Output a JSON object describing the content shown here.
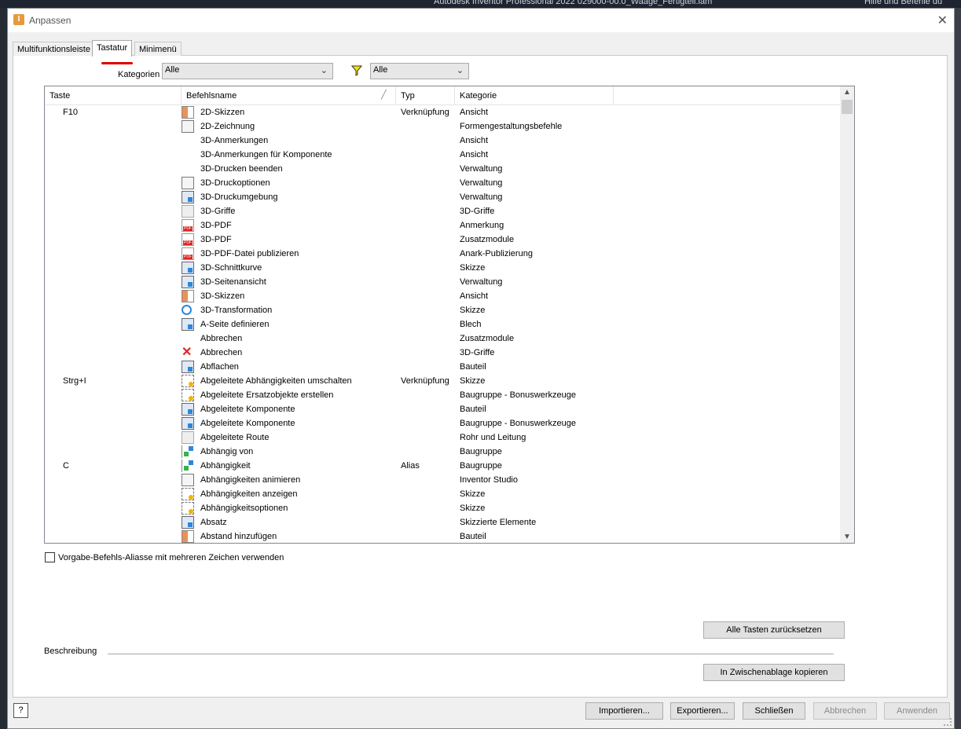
{
  "background_app": {
    "title": "Autodesk Inventor Professional 2022   029000-00.0_Waage_Fertigteil.iam",
    "right_text": "Hilfe und Befehle du"
  },
  "dialog": {
    "title": "Anpassen",
    "tabs": [
      {
        "label": "Multifunktionsleiste",
        "active": false
      },
      {
        "label": "Tastatur",
        "active": true
      },
      {
        "label": "Minimenü",
        "active": false
      }
    ]
  },
  "filters": {
    "categories_label": "Kategorien",
    "categories_value": "Alle",
    "type_value": "Alle"
  },
  "table": {
    "columns": [
      "Taste",
      "Befehlsname",
      "Typ",
      "Kategorie"
    ],
    "rows": [
      {
        "key": "F10",
        "icon": "sketch",
        "name": "2D-Skizzen",
        "type": "Verknüpfung",
        "category": "Ansicht"
      },
      {
        "key": "",
        "icon": "doc",
        "name": "2D-Zeichnung",
        "type": "",
        "category": "Formengestaltungsbefehle"
      },
      {
        "key": "",
        "icon": "none",
        "name": "3D-Anmerkungen",
        "type": "",
        "category": "Ansicht"
      },
      {
        "key": "",
        "icon": "none",
        "name": "3D-Anmerkungen für Komponente",
        "type": "",
        "category": "Ansicht"
      },
      {
        "key": "",
        "icon": "none",
        "name": "3D-Drucken beenden",
        "type": "",
        "category": "Verwaltung"
      },
      {
        "key": "",
        "icon": "doc",
        "name": "3D-Druckoptionen",
        "type": "",
        "category": "Verwaltung"
      },
      {
        "key": "",
        "icon": "blue",
        "name": "3D-Druckumgebung",
        "type": "",
        "category": "Verwaltung"
      },
      {
        "key": "",
        "icon": "plain",
        "name": "3D-Griffe",
        "type": "",
        "category": "3D-Griffe"
      },
      {
        "key": "",
        "icon": "pdf",
        "name": "3D-PDF",
        "type": "",
        "category": "Anmerkung"
      },
      {
        "key": "",
        "icon": "pdf",
        "name": "3D-PDF",
        "type": "",
        "category": "Zusatzmodule"
      },
      {
        "key": "",
        "icon": "pdf",
        "name": "3D-PDF-Datei publizieren",
        "type": "",
        "category": "Anark-Publizierung"
      },
      {
        "key": "",
        "icon": "blue",
        "name": "3D-Schnittkurve",
        "type": "",
        "category": "Skizze"
      },
      {
        "key": "",
        "icon": "blue",
        "name": "3D-Seitenansicht",
        "type": "",
        "category": "Verwaltung"
      },
      {
        "key": "",
        "icon": "sketch",
        "name": "3D-Skizzen",
        "type": "",
        "category": "Ansicht"
      },
      {
        "key": "",
        "icon": "circle",
        "name": "3D-Transformation",
        "type": "",
        "category": "Skizze"
      },
      {
        "key": "",
        "icon": "blue",
        "name": "A-Seite definieren",
        "type": "",
        "category": "Blech"
      },
      {
        "key": "",
        "icon": "none",
        "name": "Abbrechen",
        "type": "",
        "category": "Zusatzmodule"
      },
      {
        "key": "",
        "icon": "x",
        "name": "Abbrechen",
        "type": "",
        "category": "3D-Griffe"
      },
      {
        "key": "",
        "icon": "blue",
        "name": "Abflachen",
        "type": "",
        "category": "Bauteil"
      },
      {
        "key": "Strg+I",
        "icon": "cons",
        "name": "Abgeleitete Abhängigkeiten umschalten",
        "type": "Verknüpfung",
        "category": "Skizze"
      },
      {
        "key": "",
        "icon": "cons",
        "name": "Abgeleitete Ersatzobjekte erstellen",
        "type": "",
        "category": "Baugruppe - Bonuswerkzeuge"
      },
      {
        "key": "",
        "icon": "blue",
        "name": "Abgeleitete Komponente",
        "type": "",
        "category": "Bauteil"
      },
      {
        "key": "",
        "icon": "blue",
        "name": "Abgeleitete Komponente",
        "type": "",
        "category": "Baugruppe - Bonuswerkzeuge"
      },
      {
        "key": "",
        "icon": "plain",
        "name": "Abgeleitete Route",
        "type": "",
        "category": "Rohr und Leitung"
      },
      {
        "key": "",
        "icon": "green",
        "name": "Abhängig von",
        "type": "",
        "category": "Baugruppe"
      },
      {
        "key": "C",
        "icon": "green",
        "name": "Abhängigkeit",
        "type": "Alias",
        "category": "Baugruppe"
      },
      {
        "key": "",
        "icon": "doc",
        "name": "Abhängigkeiten animieren",
        "type": "",
        "category": "Inventor Studio"
      },
      {
        "key": "",
        "icon": "cons",
        "name": "Abhängigkeiten anzeigen",
        "type": "",
        "category": "Skizze"
      },
      {
        "key": "",
        "icon": "cons",
        "name": "Abhängigkeitsoptionen",
        "type": "",
        "category": "Skizze"
      },
      {
        "key": "",
        "icon": "blue",
        "name": "Absatz",
        "type": "",
        "category": "Skizzierte Elemente"
      },
      {
        "key": "",
        "icon": "sketch",
        "name": "Abstand hinzufügen",
        "type": "",
        "category": "Bauteil"
      }
    ]
  },
  "options": {
    "multi_char_alias_label": "Vorgabe-Befehls-Aliasse mit mehreren Zeichen verwenden",
    "multi_char_alias_checked": false
  },
  "buttons": {
    "reset_all": "Alle Tasten zurücksetzen",
    "copy_clipboard": "In Zwischenablage kopieren",
    "import": "Importieren...",
    "export": "Exportieren...",
    "close": "Schließen",
    "cancel": "Abbrechen",
    "apply": "Anwenden"
  },
  "description_label": "Beschreibung",
  "help_label": "?"
}
